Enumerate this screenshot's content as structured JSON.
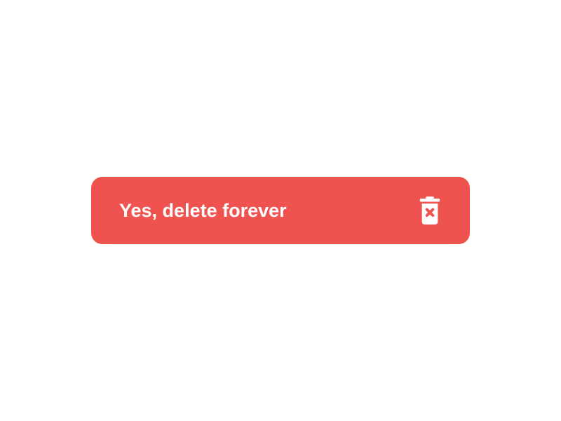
{
  "button": {
    "label": "Yes, delete forever",
    "icon": "trash-x-icon",
    "color": "#ef5350"
  }
}
